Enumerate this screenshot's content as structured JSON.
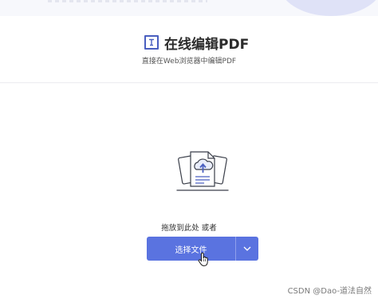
{
  "header": {
    "title": "在线编辑PDF",
    "subtitle": "直接在Web浏览器中编辑PDF"
  },
  "upload": {
    "drop_text": "拖放到此处 或者",
    "button_label": "选择文件"
  },
  "watermark": "CSDN @Dao-道法自然",
  "colors": {
    "accent": "#5a73e0",
    "icon_blue": "#4a5fc0"
  },
  "icons": [
    "text-box-icon",
    "cloud-upload-document-icon",
    "chevron-down-icon",
    "hand-pointer-icon"
  ]
}
